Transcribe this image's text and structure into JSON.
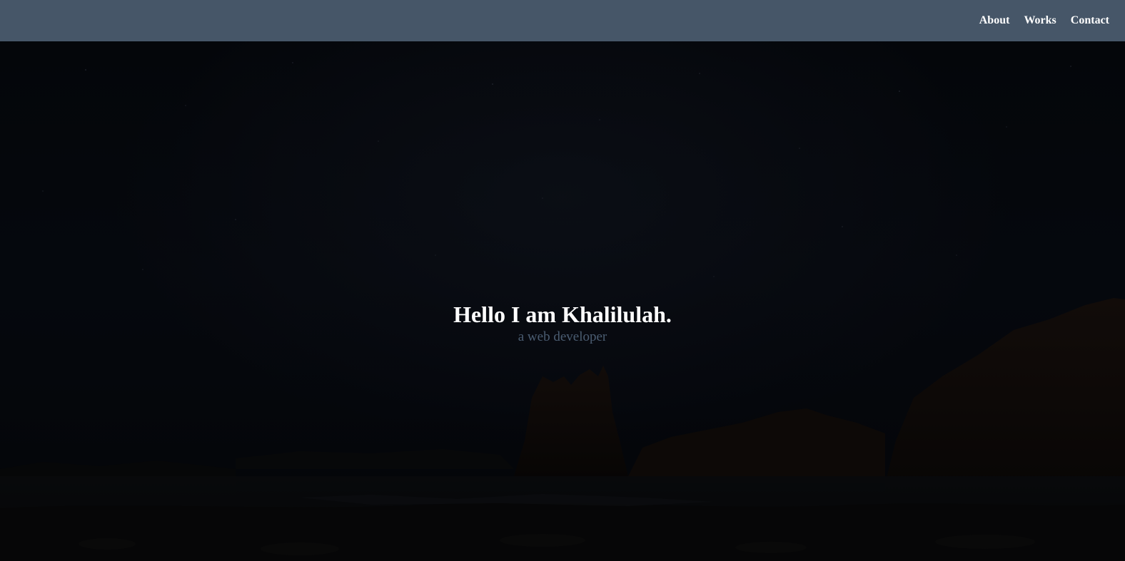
{
  "nav": {
    "items": [
      {
        "label": "About"
      },
      {
        "label": "Works"
      },
      {
        "label": "Contact"
      }
    ]
  },
  "hero": {
    "title": "Hello I am Khalilulah.",
    "subtitle": "a web developer",
    "background": "night-sky-coastal-rocks-image"
  },
  "colors": {
    "header_bg": "#465668",
    "nav_text": "#ffffff",
    "hero_bg": "#05070b",
    "title": "#ffffff",
    "subtitle": "#4b5d72"
  }
}
